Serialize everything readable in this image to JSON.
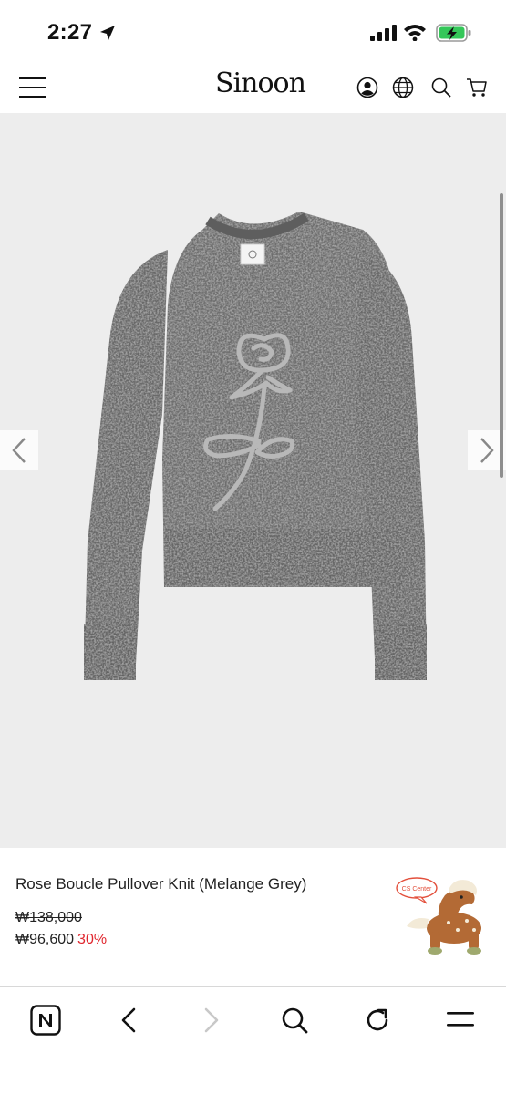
{
  "status": {
    "time": "2:27",
    "icons": [
      "location-arrow-icon",
      "cellular-signal-icon",
      "wifi-icon",
      "battery-charging-icon"
    ],
    "battery_color": "#34c759"
  },
  "header": {
    "logo": "Sinoon",
    "icons": [
      "menu-icon",
      "account-icon",
      "language-globe-icon",
      "search-icon",
      "cart-icon"
    ]
  },
  "gallery": {
    "image": "grey-rose-boucle-sweater",
    "prev_icon": "chevron-left-icon",
    "next_icon": "chevron-right-icon",
    "background": "#ededed"
  },
  "product": {
    "name": "Rose Boucle Pullover Knit (Melange Grey)",
    "price_original": "₩138,000",
    "price_sale": "₩96,600",
    "discount": "30%",
    "discount_color": "#e0252d"
  },
  "cs_widget": {
    "label": "CS Center",
    "icon": "horse-plush-icon"
  },
  "toolbar": {
    "icons": [
      "naver-n-icon",
      "back-icon",
      "forward-icon",
      "search-icon",
      "reload-icon",
      "menu-icon"
    ]
  }
}
